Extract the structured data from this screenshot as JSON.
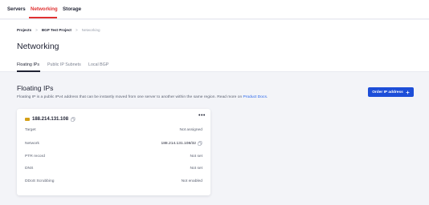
{
  "topnav": {
    "tabs": [
      {
        "label": "Servers"
      },
      {
        "label": "Networking"
      },
      {
        "label": "Storage"
      }
    ],
    "active_color": "#e03131"
  },
  "breadcrumb": {
    "items": [
      "Projects",
      "BGP Test Project",
      "Networking"
    ]
  },
  "page": {
    "title": "Networking"
  },
  "subtabs": [
    {
      "label": "Floating IPs"
    },
    {
      "label": "Public IP Subnets"
    },
    {
      "label": "Local BGP"
    }
  ],
  "section": {
    "title": "Floating IPs",
    "description": "Floating IP is a public IPv4 address that can be instantly moved from one server to another within the same region. Read more on",
    "docs_link": "Product Docs",
    "docs_suffix": "."
  },
  "order_button": {
    "label": "Order IP address",
    "color": "#1d4ed8",
    "icon": "plus-icon"
  },
  "card": {
    "ip": "188.214.131.108",
    "menu_icon": "more-horizontal-icon",
    "rows": [
      {
        "label": "Target",
        "value": "Not assigned"
      },
      {
        "label": "Network",
        "value": "188.214.131.108/32"
      },
      {
        "label": "PTR record",
        "value": "Not set"
      },
      {
        "label": "DNS",
        "value": "Not set"
      },
      {
        "label": "DDoS Scrubbing",
        "value": "Not enabled"
      }
    ]
  }
}
